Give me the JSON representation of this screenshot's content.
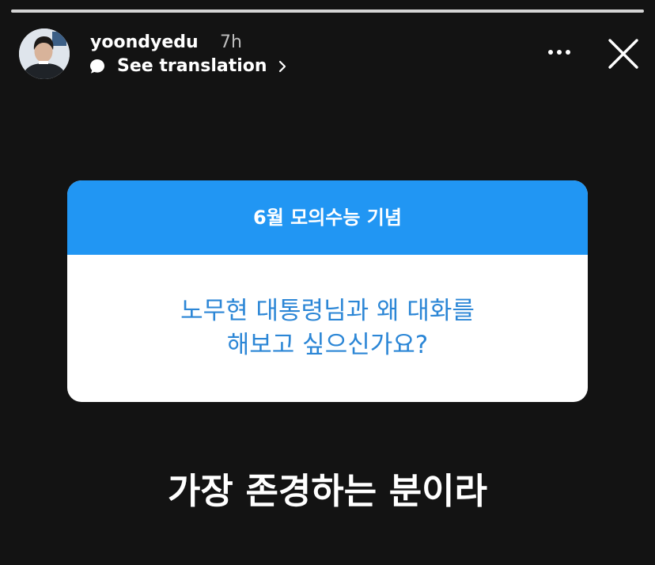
{
  "story": {
    "progress_segments": 1
  },
  "header": {
    "username": "yoondyedu",
    "timestamp": "7h",
    "translation_link": "See translation",
    "avatar_icon": "avatar",
    "translate_icon": "speech-bubble-icon",
    "more_icon": "more-horizontal-icon",
    "close_icon": "close-icon"
  },
  "question_sticker": {
    "title": "6월 모의수능 기념",
    "question": "노무현 대통령님과 왜 대화를\n해보고 싶으신가요?",
    "accent_color": "#2196f3",
    "text_color": "#2b86d6"
  },
  "answer": {
    "text": "가장 존경하는 분이라"
  }
}
